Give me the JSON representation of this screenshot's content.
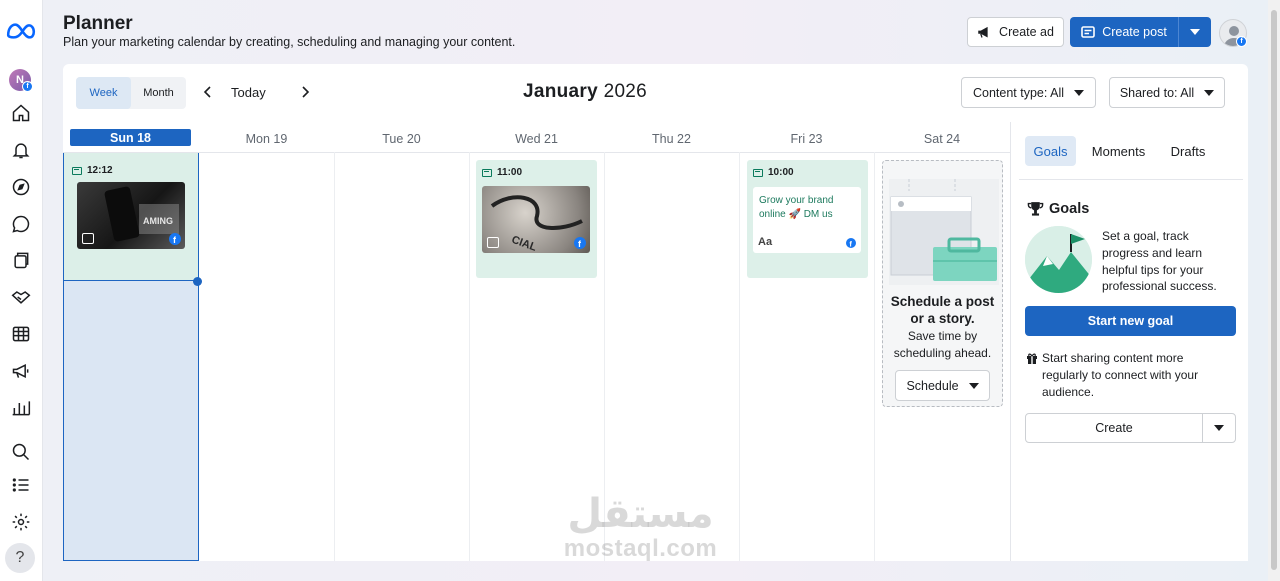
{
  "header": {
    "title": "Planner",
    "subtitle": "Plan your marketing calendar by creating, scheduling and managing your content.",
    "create_ad_label": "Create ad",
    "create_post_label": "Create post"
  },
  "sidebar": {
    "items": [
      {
        "icon": "home-icon"
      },
      {
        "icon": "bell-icon"
      },
      {
        "icon": "compass-icon"
      },
      {
        "icon": "chat-icon"
      },
      {
        "icon": "pages-icon"
      },
      {
        "icon": "handshake-icon"
      },
      {
        "icon": "table-icon"
      },
      {
        "icon": "megaphone-icon"
      },
      {
        "icon": "insights-icon"
      },
      {
        "icon": "search-icon"
      },
      {
        "icon": "list-icon"
      },
      {
        "icon": "gear-icon"
      }
    ],
    "help_label": "?"
  },
  "toolbar": {
    "week_label": "Week",
    "month_label": "Month",
    "today_label": "Today",
    "month_title_bold": "January",
    "month_title_year": "2026",
    "content_type_label": "Content type: All",
    "shared_to_label": "Shared to: All"
  },
  "days": [
    "Sun 18",
    "Mon 19",
    "Tue 20",
    "Wed 21",
    "Thu 22",
    "Fri 23",
    "Sat 24"
  ],
  "posts": [
    {
      "day": "Sun 18",
      "time": "12:12"
    },
    {
      "day": "Wed 21",
      "time": "11:00"
    },
    {
      "day": "Fri 23",
      "time": "10:00",
      "text": "Grow your brand online 🚀 DM us",
      "text_icon": "Aa"
    }
  ],
  "schedule_card": {
    "title": "Schedule a post or a story.",
    "subtitle": "Save time by scheduling ahead.",
    "button_label": "Schedule"
  },
  "panel": {
    "tabs": [
      "Goals",
      "Moments",
      "Drafts"
    ],
    "active_tab": "Goals",
    "goals_heading": "Goals",
    "goal_text": "Set a goal, track progress and learn helpful tips for your professional success.",
    "start_goal_label": "Start new goal",
    "share_text": "Start sharing content more regularly to connect with your audience.",
    "create_label": "Create"
  },
  "watermark": {
    "arabic": "مستقل",
    "latin": "mostaql.com"
  },
  "colors": {
    "accent": "#1d65c1",
    "post_bg": "#ddf0e9",
    "selected_column": "#dbe6f3"
  }
}
